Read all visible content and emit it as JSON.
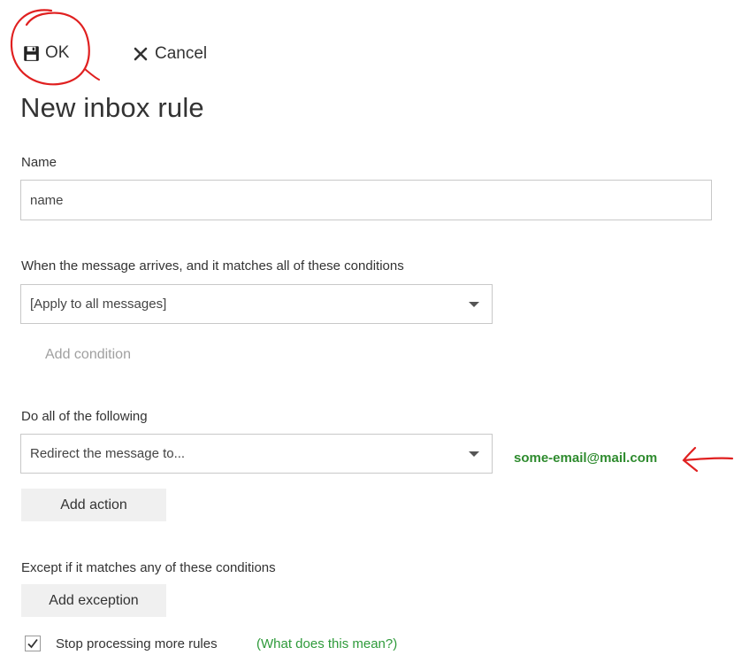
{
  "toolbar": {
    "ok_label": "OK",
    "cancel_label": "Cancel"
  },
  "page": {
    "title": "New inbox rule"
  },
  "name_section": {
    "label": "Name",
    "value": "name"
  },
  "conditions": {
    "label": "When the message arrives, and it matches all of these conditions",
    "selected": "[Apply to all messages]",
    "add_label": "Add condition"
  },
  "actions": {
    "label": "Do all of the following",
    "selected": "Redirect the message to...",
    "recipient": "some-email@mail.com",
    "add_label": "Add action"
  },
  "exceptions": {
    "label": "Except if it matches any of these conditions",
    "add_label": "Add exception"
  },
  "stop_processing": {
    "checked": true,
    "label": "Stop processing more rules",
    "help_link": "(What does this mean?)"
  },
  "colors": {
    "annotation": "#e02020",
    "recipient_text": "#2e8b2e",
    "help_link": "#2e9a3a"
  },
  "icons": {
    "ok": "save-icon",
    "cancel": "close-icon",
    "checkbox": "checkmark-icon"
  }
}
